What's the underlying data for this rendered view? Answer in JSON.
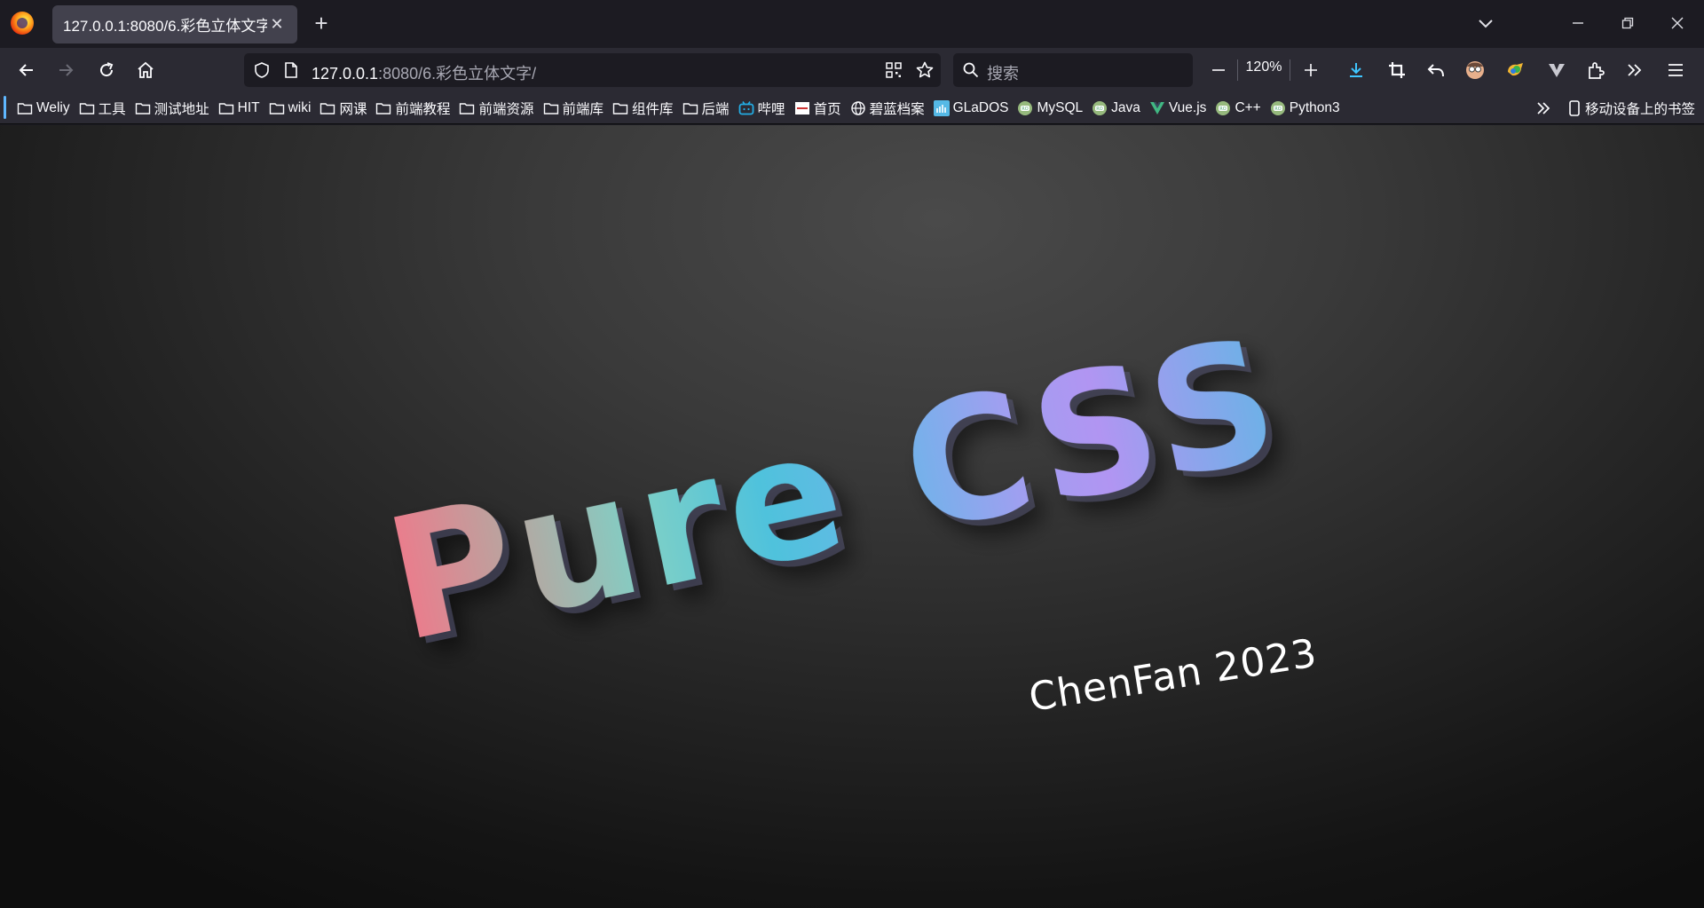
{
  "tab": {
    "title": "127.0.0.1:8080/6.彩色立体文字/",
    "close_glyph": "✕",
    "new_tab_glyph": "+"
  },
  "window_controls": {
    "list_tabs_icon": "chevron-down-icon",
    "minimize_glyph": "—",
    "restore_glyph": "❐",
    "close_glyph": "✕"
  },
  "navbar": {
    "url_host": "127.0.0.1",
    "url_path": ":8080/6.彩色立体文字/",
    "search_placeholder": "搜索",
    "zoom_level": "120%"
  },
  "bookmarks": {
    "items": [
      {
        "label": "Weliy",
        "icon": "folder-icon"
      },
      {
        "label": "工具",
        "icon": "folder-icon"
      },
      {
        "label": "测试地址",
        "icon": "folder-icon"
      },
      {
        "label": "HIT",
        "icon": "folder-icon"
      },
      {
        "label": "wiki",
        "icon": "folder-icon"
      },
      {
        "label": "网课",
        "icon": "folder-icon"
      },
      {
        "label": "前端教程",
        "icon": "folder-icon"
      },
      {
        "label": "前端资源",
        "icon": "folder-icon"
      },
      {
        "label": "前端库",
        "icon": "folder-icon"
      },
      {
        "label": "组件库",
        "icon": "folder-icon"
      },
      {
        "label": "后端",
        "icon": "folder-icon"
      },
      {
        "label": "哔哩",
        "icon": "bilibili-icon"
      },
      {
        "label": "首页",
        "icon": "site-favicon-icon"
      },
      {
        "label": "碧蓝档案",
        "icon": "globe-icon"
      },
      {
        "label": "GLaDOS",
        "icon": "glados-icon"
      },
      {
        "label": "MySQL",
        "icon": "runoob-icon"
      },
      {
        "label": "Java",
        "icon": "runoob-icon"
      },
      {
        "label": "Vue.js",
        "icon": "vue-icon"
      },
      {
        "label": "C++",
        "icon": "runoob-icon"
      },
      {
        "label": "Python3",
        "icon": "runoob-icon"
      }
    ],
    "mobile_label": "移动设备上的书签"
  },
  "page": {
    "headline": "Pure CSS",
    "signature": "ChenFan 2023",
    "colors": {
      "gradient": [
        "#f0788a",
        "#7fd0c6",
        "#4fc2dc",
        "#b195f2",
        "#68b3e6"
      ],
      "background": "#2a2a2a"
    }
  }
}
